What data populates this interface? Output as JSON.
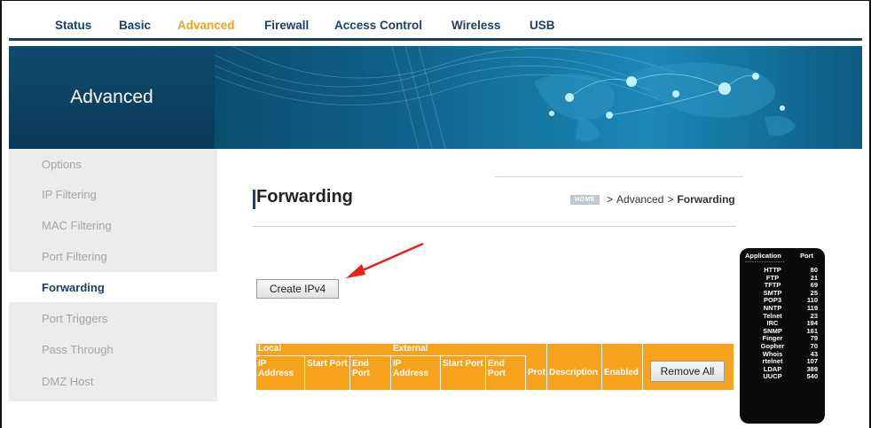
{
  "nav": {
    "tabs": [
      {
        "label": "Status",
        "active": false
      },
      {
        "label": "Basic",
        "active": false
      },
      {
        "label": "Advanced",
        "active": true
      },
      {
        "label": "Firewall",
        "active": false
      },
      {
        "label": "Access Control",
        "active": false
      },
      {
        "label": "Wireless",
        "active": false
      },
      {
        "label": "USB",
        "active": false
      }
    ]
  },
  "banner": {
    "title": "Advanced"
  },
  "sidebar": {
    "items": [
      {
        "label": "Options",
        "active": false
      },
      {
        "label": "IP Filtering",
        "active": false
      },
      {
        "label": "MAC Filtering",
        "active": false
      },
      {
        "label": "Port Filtering",
        "active": false
      },
      {
        "label": "Forwarding",
        "active": true
      },
      {
        "label": "Port Triggers",
        "active": false
      },
      {
        "label": "Pass Through",
        "active": false
      },
      {
        "label": "DMZ Host",
        "active": false
      }
    ]
  },
  "page": {
    "title": "Forwarding",
    "breadcrumb": {
      "home": "HOME",
      "sep": ">",
      "section": "Advanced",
      "current": "Forwarding"
    }
  },
  "actions": {
    "create_label": "Create IPv4",
    "remove_all_label": "Remove All"
  },
  "table": {
    "groups": {
      "local": "Local",
      "external": "External"
    },
    "columns": {
      "local_ip": "IP Address",
      "local_start": "Start Port",
      "local_end": "End Port",
      "ext_ip": "IP Address",
      "ext_start": "Start Port",
      "ext_end": "End Port",
      "prot": "Prot",
      "description": "Description",
      "enabled": "Enabled"
    }
  },
  "ports_panel": {
    "header_app": "Application",
    "header_port": "Port",
    "rows": [
      {
        "app": "HTTP",
        "port": "80"
      },
      {
        "app": "FTP",
        "port": "21"
      },
      {
        "app": "TFTP",
        "port": "69"
      },
      {
        "app": "SMTP",
        "port": "25"
      },
      {
        "app": "POP3",
        "port": "110"
      },
      {
        "app": "NNTP",
        "port": "119"
      },
      {
        "app": "Telnet",
        "port": "23"
      },
      {
        "app": "IRC",
        "port": "194"
      },
      {
        "app": "SNMP",
        "port": "161"
      },
      {
        "app": "Finger",
        "port": "79"
      },
      {
        "app": "Gopher",
        "port": "70"
      },
      {
        "app": "Whois",
        "port": "43"
      },
      {
        "app": "rtelnet",
        "port": "107"
      },
      {
        "app": "LDAP",
        "port": "389"
      },
      {
        "app": "UUCP",
        "port": "540"
      }
    ]
  },
  "colors": {
    "accent": "#f7a21c",
    "nav_text": "#1d3f6a",
    "nav_active": "#f3a21a",
    "annotation_arrow": "#e8201c"
  }
}
